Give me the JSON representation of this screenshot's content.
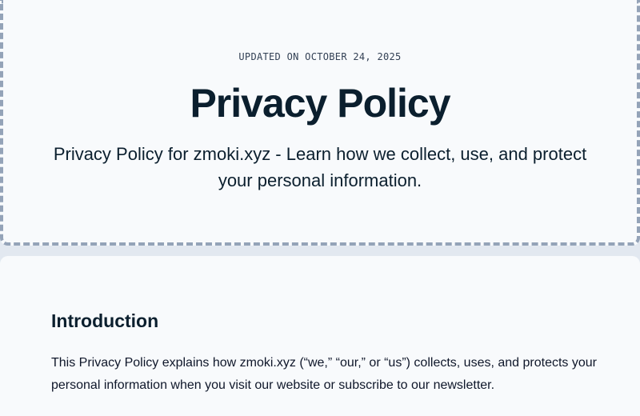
{
  "header": {
    "updated": "UPDATED ON OCTOBER 24, 2025",
    "title": "Privacy Policy",
    "subtitle": "Privacy Policy for zmoki.xyz - Learn how we collect, use, and protect your personal information."
  },
  "content": {
    "introduction_heading": "Introduction",
    "introduction_text": "This Privacy Policy explains how zmoki.xyz (“we,” “our,” or “us”) collects, uses, and protects your personal information when you visit our website or subscribe to our newsletter."
  },
  "colors": {
    "page_background": "#e2e8f0",
    "card_background": "#f8fafc",
    "dashed_border": "#94a3b8",
    "heading_text": "#0b1f2e"
  }
}
